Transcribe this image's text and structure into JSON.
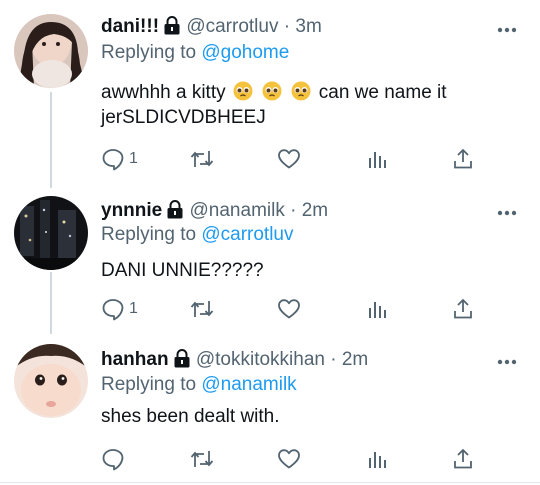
{
  "tweets": [
    {
      "display_name": "dani!!!",
      "handle": "@carrotluv",
      "separator": "·",
      "time": "3m",
      "replying_prefix": "Replying to",
      "replying_to": "@gohome",
      "text_before_emoji": "awwhhh a kitty",
      "text_after_emoji": "can we name it jerSLDICVDBHEEJ",
      "emoji": [
        "pleading-face-icon",
        "pleading-face-icon",
        "pleading-face-icon"
      ],
      "reply_count": "1"
    },
    {
      "display_name": "ynnnie",
      "handle": "@nanamilk",
      "separator": "·",
      "time": "2m",
      "replying_prefix": "Replying to",
      "replying_to": "@carrotluv",
      "text": "DANI UNNIE?????",
      "reply_count": "1"
    },
    {
      "display_name": "hanhan",
      "handle": "@tokkitokkihan",
      "separator": "·",
      "time": "2m",
      "replying_prefix": "Replying to",
      "replying_to": "@nanamilk",
      "text": "shes been dealt with.",
      "reply_count": ""
    }
  ],
  "colors": {
    "link": "#1d9bf0",
    "secondary_text": "#536471",
    "primary_text": "#0f1419",
    "thread_line": "#cfd9de"
  }
}
